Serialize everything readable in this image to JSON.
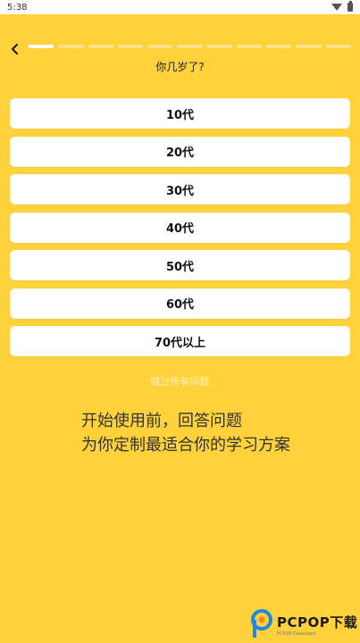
{
  "status_bar": {
    "time": "5:38"
  },
  "progress": {
    "total_steps": 11,
    "current_step": 1
  },
  "question": "你几岁了?",
  "options": [
    "10代",
    "20代",
    "30代",
    "40代",
    "50代",
    "60代",
    "70代以上"
  ],
  "skip_label": "跳过所有问题",
  "tagline": {
    "line1": "开始使用前，回答问题",
    "line2": "为你定制最适合你的学习方案"
  },
  "watermark": {
    "main": "PCPOP下载",
    "sub": "PCPOP Download"
  },
  "colors": {
    "background": "#FFD23C",
    "card": "#FFFFFF",
    "progress_active": "#FFFFFF",
    "progress_inactive": "#FFE38A"
  }
}
